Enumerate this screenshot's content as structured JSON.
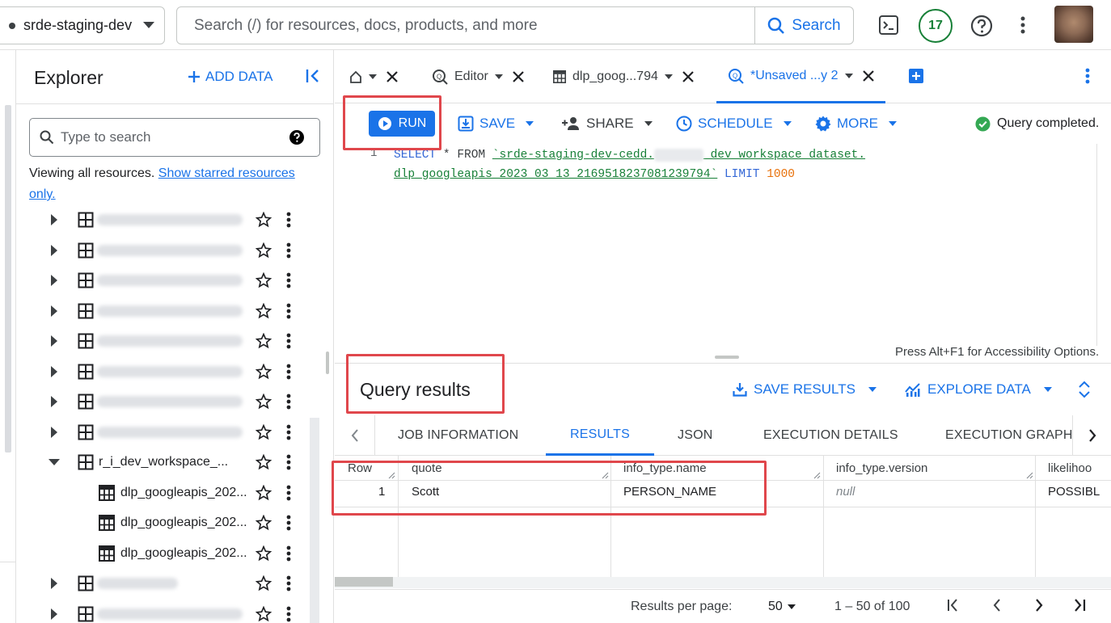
{
  "topbar": {
    "project": "srde-staging-dev",
    "search_placeholder": "Search (/) for resources, docs, products, and more",
    "search_button": "Search",
    "notifications": "17"
  },
  "explorer": {
    "title": "Explorer",
    "add_data": "ADD DATA",
    "search_placeholder": "Type to search",
    "viewing_text": "Viewing all resources. ",
    "viewing_link": "Show starred resources only.",
    "expanded_dataset": "r_i_dev_workspace_...",
    "tables": [
      "dlp_googleapis_202...",
      "dlp_googleapis_202...",
      "dlp_googleapis_202..."
    ]
  },
  "tabs": {
    "editor": "Editor",
    "dlp": "dlp_goog...794",
    "unsaved": "*Unsaved ...y 2"
  },
  "toolbar": {
    "run": "RUN",
    "save": "SAVE",
    "share": "SHARE",
    "schedule": "SCHEDULE",
    "more": "MORE",
    "status": "Query completed."
  },
  "editor": {
    "line_number": "1",
    "kw_select": "SELECT",
    "star_from": " * FROM ",
    "str_part1": "`srde-staging-dev-cedd.",
    "str_part2": "_dev_workspace_dataset.",
    "str_line2": "dlp_googleapis_2023_03_13_2169518237081239794`",
    "kw_limit": " LIMIT ",
    "limit_value": "1000",
    "accessibility": "Press Alt+F1 for Accessibility Options."
  },
  "results": {
    "title": "Query results",
    "save_results": "SAVE RESULTS",
    "explore_data": "EXPLORE DATA",
    "tabs": [
      "JOB INFORMATION",
      "RESULTS",
      "JSON",
      "EXECUTION DETAILS",
      "EXECUTION GRAPH"
    ],
    "columns": [
      "Row",
      "quote",
      "info_type.name",
      "info_type.version",
      "likelihoo"
    ],
    "row": {
      "num": "1",
      "quote": "Scott",
      "info_type_name": "PERSON_NAME",
      "info_type_version": "null",
      "likelihood": "POSSIBL"
    }
  },
  "pager": {
    "label": "Results per page:",
    "value": "50",
    "range": "1 – 50 of 100"
  },
  "colors": {
    "accent": "#1a73e8",
    "highlight": "#e0474c",
    "success": "#188038"
  }
}
